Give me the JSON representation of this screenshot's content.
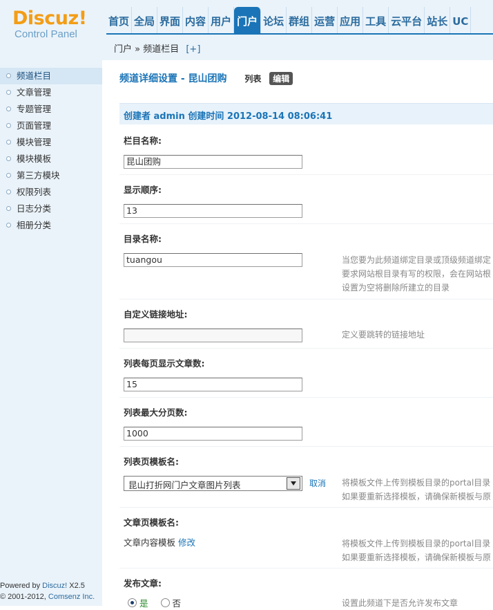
{
  "app": {
    "logo_text": "Discuz",
    "logo_bang": "!",
    "logo_sub": "Control Panel"
  },
  "nav": {
    "items": [
      "首页",
      "全局",
      "界面",
      "内容",
      "用户",
      "门户",
      "论坛",
      "群组",
      "运营",
      "应用",
      "工具",
      "云平台",
      "站长",
      "UC"
    ],
    "active_index": 5
  },
  "breadcrumb": {
    "path": "门户 » 频道栏目",
    "plus": "[+]"
  },
  "sidebar": {
    "items": [
      {
        "label": "频道栏目",
        "active": true
      },
      {
        "label": "文章管理",
        "active": false
      },
      {
        "label": "专题管理",
        "active": false
      },
      {
        "label": "页面管理",
        "active": false
      },
      {
        "label": "模块管理",
        "active": false
      },
      {
        "label": "模块模板",
        "active": false
      },
      {
        "label": "第三方模块",
        "active": false
      },
      {
        "label": "权限列表",
        "active": false
      },
      {
        "label": "日志分类",
        "active": false
      },
      {
        "label": "相册分类",
        "active": false
      }
    ],
    "footer_powered": "Powered by ",
    "footer_product": "Discuz!",
    "footer_version": " X2.5",
    "footer_copyright": "© 2001-2012, ",
    "footer_company": "Comsenz Inc."
  },
  "main": {
    "title": "频道详细设置 - 昆山团购",
    "tab_list": "列表",
    "tab_edit": "编辑",
    "creator_line": "创建者 admin 创建时间 2012-08-14 08:06:41",
    "fields": {
      "column_name": {
        "label": "栏目名称:",
        "value": "昆山团购"
      },
      "display_order": {
        "label": "显示顺序:",
        "value": "13"
      },
      "dir_name": {
        "label": "目录名称:",
        "value": "tuangou",
        "tip1": "当您要为此频道绑定目录或顶级频道绑定",
        "tip2": "要求网站根目录有写的权限，会在网站根",
        "tip3": "设置为空将删除所建立的目录"
      },
      "custom_url": {
        "label": "自定义链接地址:",
        "value": "",
        "tip": "定义要跳转的链接地址"
      },
      "per_page": {
        "label": "列表每页显示文章数:",
        "value": "15"
      },
      "max_pages": {
        "label": "列表最大分页数:",
        "value": "1000"
      },
      "list_template": {
        "label": "列表页模板名:",
        "selected": "昆山打折网门户文章图片列表",
        "cancel": "取消",
        "tip1": "将模板文件上传到模板目录的portal目录",
        "tip2": "如果要重新选择模板，请确保新模板与原"
      },
      "article_template": {
        "label": "文章页模板名:",
        "value": "文章内容模板",
        "edit": "修改",
        "tip1": "将模板文件上传到模板目录的portal目录",
        "tip2": "如果要重新选择模板，请确保新模板与原"
      },
      "publish": {
        "label": "发布文章:",
        "yes": "是",
        "no": "否",
        "selected": "yes",
        "tip": "设置此频道下是否允许发布文章"
      }
    }
  },
  "colors": {
    "accent": "#1a74b7",
    "header_bg": "#eaf3fa",
    "logo": "#f39d16"
  }
}
